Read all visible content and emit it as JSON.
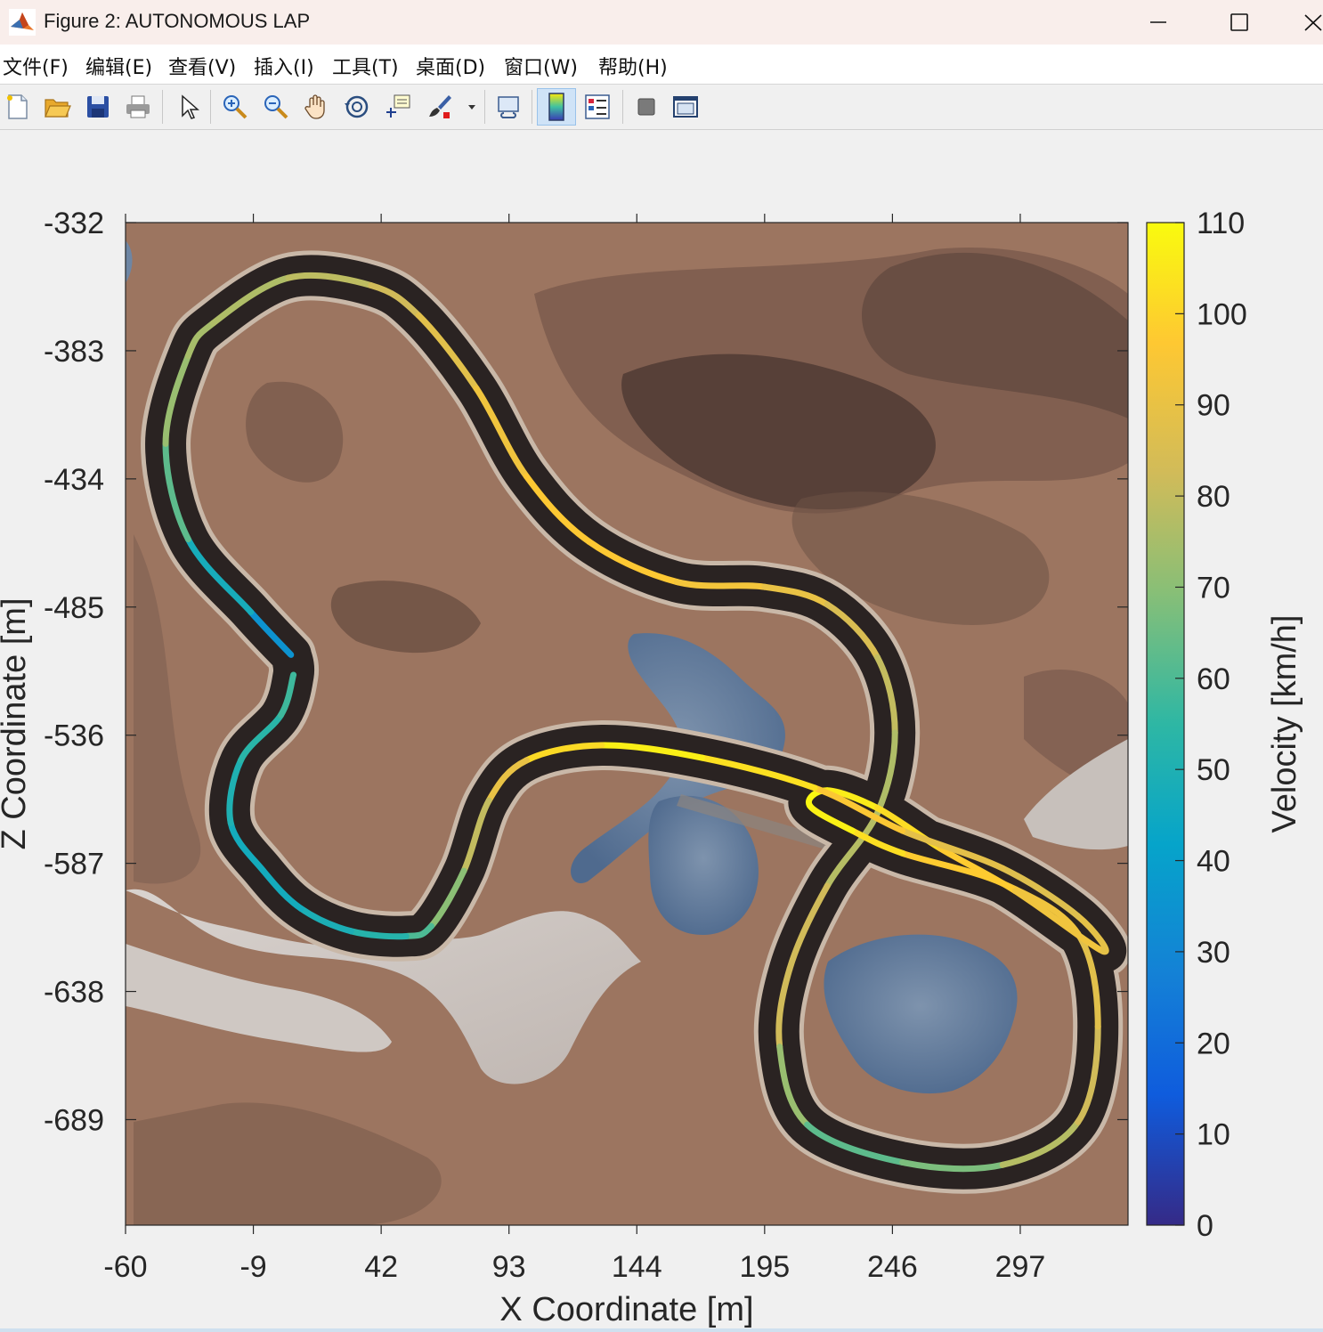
{
  "window": {
    "title": "Figure 2: AUTONOMOUS LAP",
    "icon": "matlab-logo-icon",
    "controls": [
      "minimize-icon",
      "maximize-icon",
      "close-icon"
    ]
  },
  "menu": {
    "items": [
      "文件(F)",
      "编辑(E)",
      "查看(V)",
      "插入(I)",
      "工具(T)",
      "桌面(D)",
      "窗口(W)",
      "帮助(H)"
    ]
  },
  "toolbar": {
    "buttons": [
      "new-figure-icon",
      "open-file-icon",
      "save-icon",
      "print-icon",
      "edit-plot-arrow-icon",
      "zoom-in-icon",
      "zoom-out-icon",
      "pan-hand-icon",
      "rotate-3d-icon",
      "data-cursor-icon",
      "brush-icon",
      "brush-dropdown-icon",
      "link-plot-icon",
      "insert-colorbar-icon",
      "insert-legend-icon",
      "hide-plot-tools-icon",
      "show-plot-tools-icon"
    ],
    "active": "insert-colorbar-icon"
  },
  "chart_data": {
    "type": "line",
    "title": "",
    "xlabel": "X Coordinate [m]",
    "ylabel": "Z Coordinate [m]",
    "xlim": [
      -60,
      340
    ],
    "ylim": [
      -731,
      -332
    ],
    "y_reversed": true,
    "xticks": [
      "-60",
      "-9",
      "42",
      "93",
      "144",
      "195",
      "246",
      "297"
    ],
    "yticks": [
      "-332",
      "-383",
      "-434",
      "-485",
      "-536",
      "-587",
      "-638",
      "-689"
    ],
    "background": "terrain-texture",
    "colorbar": {
      "label": "Velocity [km/h]",
      "limits": [
        0,
        110
      ],
      "ticks": [
        "0",
        "10",
        "20",
        "30",
        "40",
        "50",
        "60",
        "70",
        "80",
        "90",
        "100",
        "110"
      ],
      "colormap": "parula"
    },
    "series": [
      {
        "x": [
          6,
          -10,
          -35,
          -44,
          -35,
          -25,
          5,
          38,
          57,
          80,
          100,
          125,
          160,
          195,
          220,
          240,
          247,
          240,
          220,
          205,
          201,
          212,
          250,
          290,
          320,
          328,
          320,
          290,
          250,
          230,
          213,
          220,
          240,
          265,
          295,
          330,
          320,
          290,
          250,
          215,
          170,
          130,
          100,
          85,
          75,
          62,
          52,
          30,
          10,
          -5,
          -18,
          -14,
          2,
          7
        ],
        "z": [
          -504,
          -487,
          -458,
          -420,
          -385,
          -372,
          -354,
          -357,
          -369,
          -398,
          -433,
          -459,
          -475,
          -477,
          -484,
          -505,
          -535,
          -567,
          -596,
          -629,
          -660,
          -691,
          -706,
          -707,
          -690,
          -652,
          -615,
          -595,
          -583,
          -574,
          -564,
          -558,
          -565,
          -581,
          -598,
          -622,
          -608,
          -589,
          -574,
          -557,
          -545,
          -540,
          -546,
          -562,
          -590,
          -612,
          -616,
          -614,
          -605,
          -590,
          -571,
          -546,
          -528,
          -512
        ],
        "velocity": [
          30,
          40,
          55,
          70,
          75,
          75,
          78,
          80,
          85,
          90,
          95,
          98,
          95,
          92,
          88,
          82,
          78,
          75,
          80,
          85,
          80,
          65,
          60,
          75,
          80,
          85,
          90,
          95,
          100,
          105,
          110,
          108,
          104,
          100,
          95,
          90,
          88,
          85,
          92,
          100,
          106,
          108,
          95,
          85,
          75,
          65,
          55,
          50,
          48,
          45,
          48,
          52,
          55,
          60
        ]
      }
    ]
  }
}
